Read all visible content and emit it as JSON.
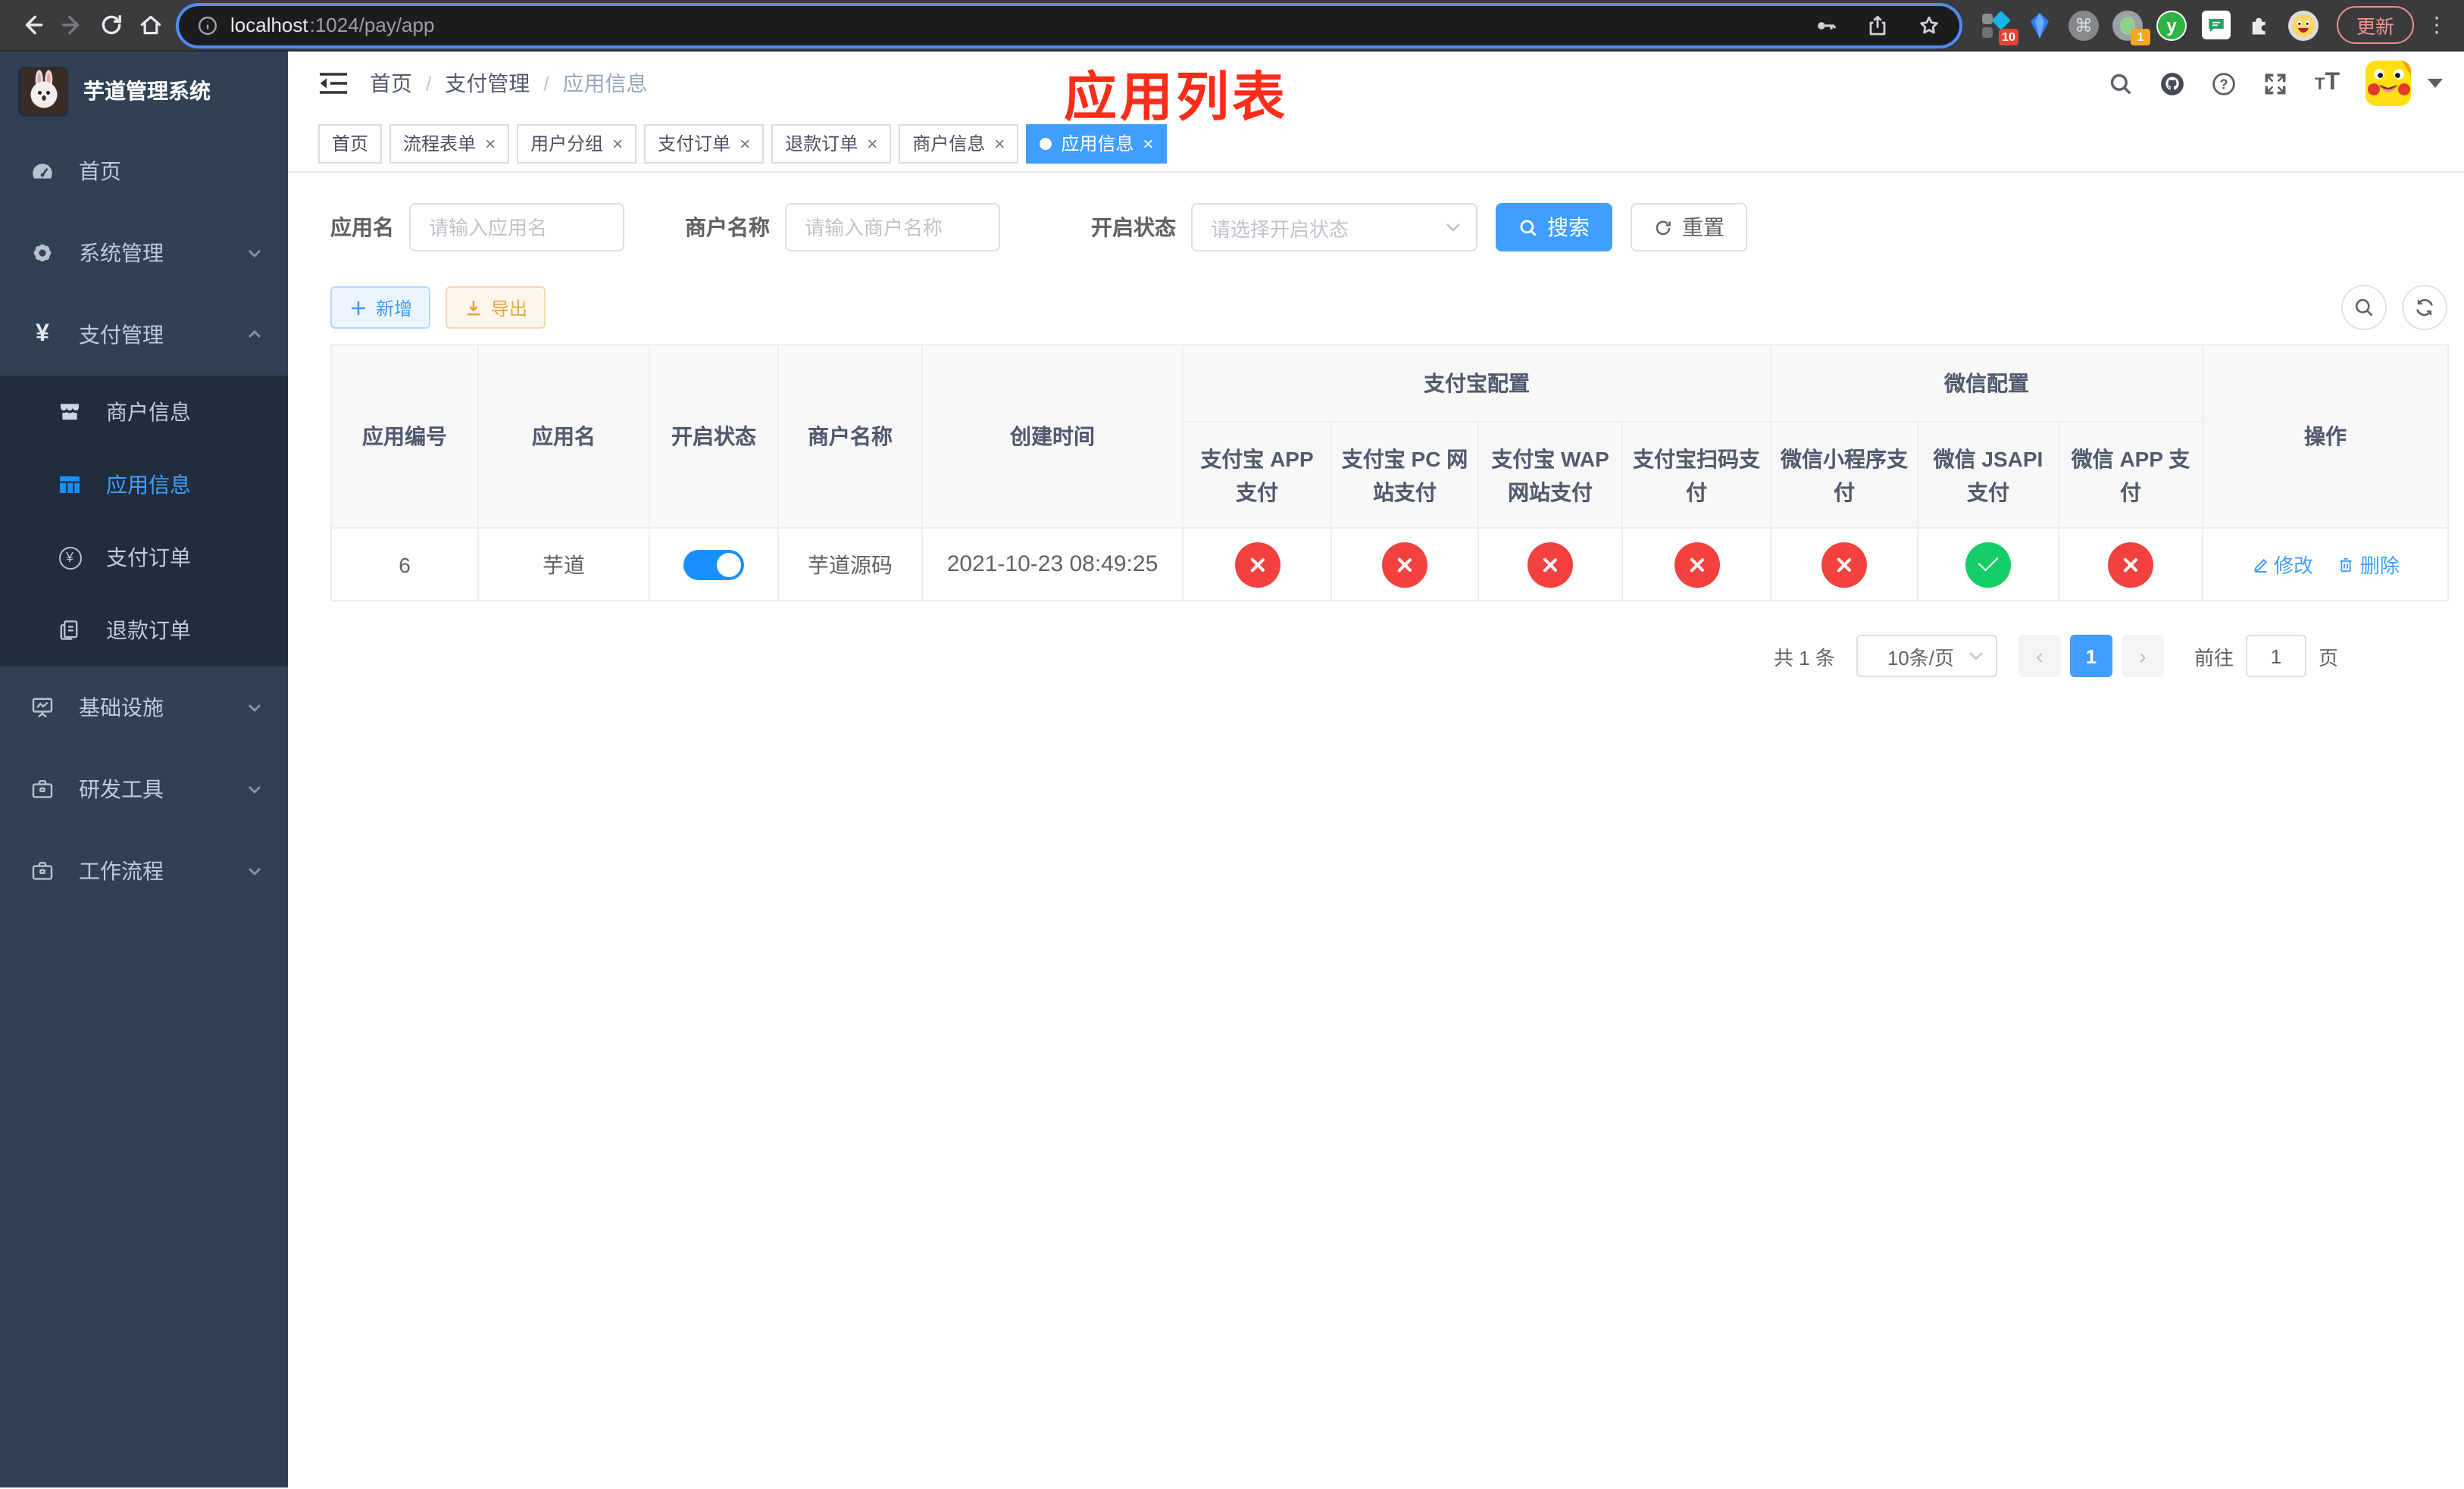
{
  "browser": {
    "url_host": "localhost",
    "url_path": ":1024/pay/app",
    "update_label": "更新",
    "ext_badge_ten": "10",
    "ext_badge_one": "1",
    "ext_y_label": "y"
  },
  "icons": {
    "yen": "¥",
    "question": "?",
    "close": "×",
    "prev": "‹",
    "next": "›",
    "more": "⋮",
    "command": "⌘",
    "font_small": "T",
    "font_large": "T"
  },
  "sidebar": {
    "title": "芋道管理系统",
    "items": {
      "home": "首页",
      "system": "系统管理",
      "payment": "支付管理",
      "infra": "基础设施",
      "devtools": "研发工具",
      "workflow": "工作流程"
    },
    "payment_children": {
      "merchant": "商户信息",
      "app": "应用信息",
      "pay_order": "支付订单",
      "refund_order": "退款订单"
    }
  },
  "navbar": {
    "breadcrumb": [
      "首页",
      "支付管理",
      "应用信息"
    ],
    "separator": "/"
  },
  "overlay_title": "应用列表",
  "tabs": [
    {
      "label": "首页"
    },
    {
      "label": "流程表单"
    },
    {
      "label": "用户分组"
    },
    {
      "label": "支付订单"
    },
    {
      "label": "退款订单"
    },
    {
      "label": "商户信息"
    },
    {
      "label": "应用信息"
    }
  ],
  "filters": {
    "app_label": "应用名",
    "app_placeholder": "请输入应用名",
    "merchant_label": "商户名称",
    "merchant_placeholder": "请输入商户名称",
    "status_label": "开启状态",
    "status_placeholder": "请选择开启状态",
    "search_label": "搜索",
    "reset_label": "重置"
  },
  "toolbar": {
    "add_label": "新增",
    "export_label": "导出"
  },
  "table": {
    "columns": [
      "应用编号",
      "应用名",
      "开启状态",
      "商户名称",
      "创建时间"
    ],
    "group_alipay": "支付宝配置",
    "alipay_cols": [
      "支付宝 APP 支付",
      "支付宝 PC 网站支付",
      "支付宝 WAP 网站支付",
      "支付宝扫码支付"
    ],
    "group_wechat": "微信配置",
    "wechat_cols": [
      "微信小程序支付",
      "微信 JSAPI 支付",
      "微信 APP 支付"
    ],
    "action_col": "操作",
    "row": {
      "id": "6",
      "name": "芋道",
      "enabled": "on",
      "merchant": "芋道源码",
      "created": "2021-10-23 08:49:25",
      "configs": [
        "no",
        "no",
        "no",
        "no",
        "no",
        "yes",
        "no"
      ],
      "edit_label": "修改",
      "delete_label": "删除"
    }
  },
  "pagination": {
    "total": "共 1 条",
    "size": "10条/页",
    "page": "1",
    "goto_label": "前往",
    "goto_value": "1",
    "unit_label": "页"
  },
  "colors": {
    "accent": "#409eff",
    "success": "#13ce66",
    "danger": "#f2413e",
    "title_red": "#fe2c19",
    "sidebar_bg": "#304156",
    "submenu_bg": "#1f2d3d"
  }
}
